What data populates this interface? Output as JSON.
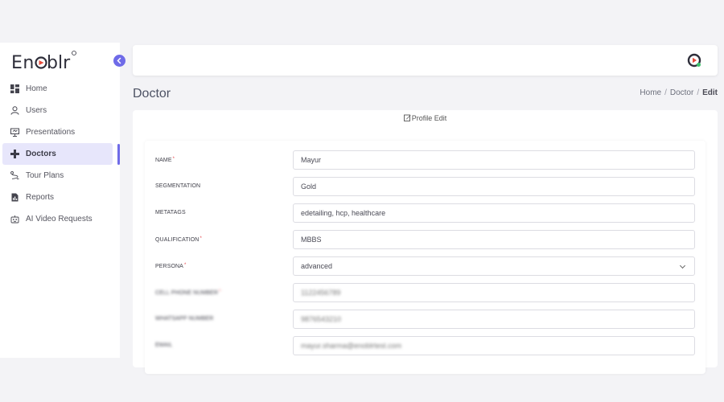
{
  "app": {
    "logo_text": "Enoblr"
  },
  "sidebar": {
    "items": [
      {
        "label": "Home",
        "icon": "dashboard-icon",
        "active": false
      },
      {
        "label": "Users",
        "icon": "user-icon",
        "active": false
      },
      {
        "label": "Presentations",
        "icon": "presentation-icon",
        "active": false
      },
      {
        "label": "Doctors",
        "icon": "plus-icon",
        "active": true
      },
      {
        "label": "Tour Plans",
        "icon": "route-icon",
        "active": false
      },
      {
        "label": "Reports",
        "icon": "report-icon",
        "active": false
      },
      {
        "label": "AI Video Requests",
        "icon": "robot-icon",
        "active": false
      }
    ]
  },
  "page": {
    "title": "Doctor"
  },
  "breadcrumb": {
    "home": "Home",
    "section": "Doctor",
    "current": "Edit"
  },
  "card": {
    "title": "Profile Edit"
  },
  "form": {
    "fields": [
      {
        "label": "NAME",
        "required": true,
        "value": "Mayur",
        "type": "text"
      },
      {
        "label": "SEGMENTATION",
        "required": false,
        "value": "Gold",
        "type": "text"
      },
      {
        "label": "METATAGS",
        "required": false,
        "value": "edetailing, hcp, healthcare",
        "type": "text"
      },
      {
        "label": "QUALIFICATION",
        "required": true,
        "value": "MBBS",
        "type": "text"
      },
      {
        "label": "PERSONA",
        "required": true,
        "value": "advanced",
        "type": "select"
      },
      {
        "label": "CELL PHONE NUMBER",
        "required": true,
        "value": "1122456789",
        "type": "text",
        "blurred": true
      },
      {
        "label": "WHATSAPP NUMBER",
        "required": false,
        "value": "9876543210",
        "type": "text",
        "blurred": true
      },
      {
        "label": "EMAIL",
        "required": false,
        "value": "mayur.sharma@enoblrtest.com",
        "type": "text",
        "blurred": true
      }
    ]
  },
  "colors": {
    "accent": "#6f6be8",
    "required": "#e5484d",
    "active_bg": "#e7e6fb"
  }
}
